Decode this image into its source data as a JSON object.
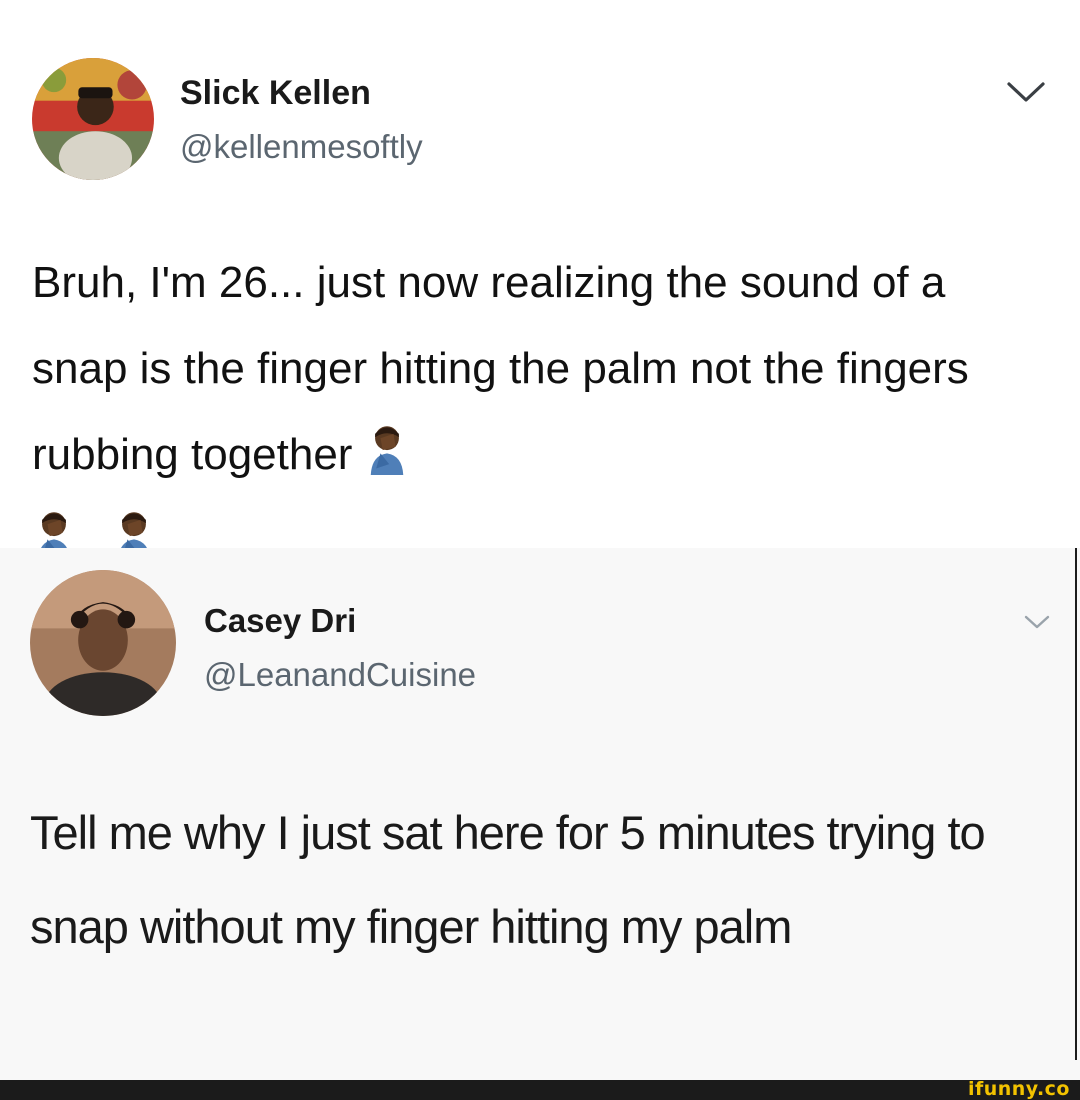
{
  "tweets": [
    {
      "display_name": "Slick Kellen",
      "handle": "@kellenmesoftly",
      "text": "Bruh, I'm 26... just now realizing the sound of a snap is the finger hitting the palm not the fingers rubbing together",
      "emoji": [
        "facepalm-icon",
        "facepalm-icon",
        "facepalm-icon"
      ]
    },
    {
      "display_name": "Casey Dri",
      "handle": "@LeanandCuisine",
      "text": "Tell me why I just sat here for 5 minutes trying to snap without my finger hitting my palm"
    }
  ],
  "watermark": "ifunny.co",
  "colors": {
    "handle": "#5b6670",
    "watermark": "#f2c200",
    "footer": "#1b1b1b"
  }
}
